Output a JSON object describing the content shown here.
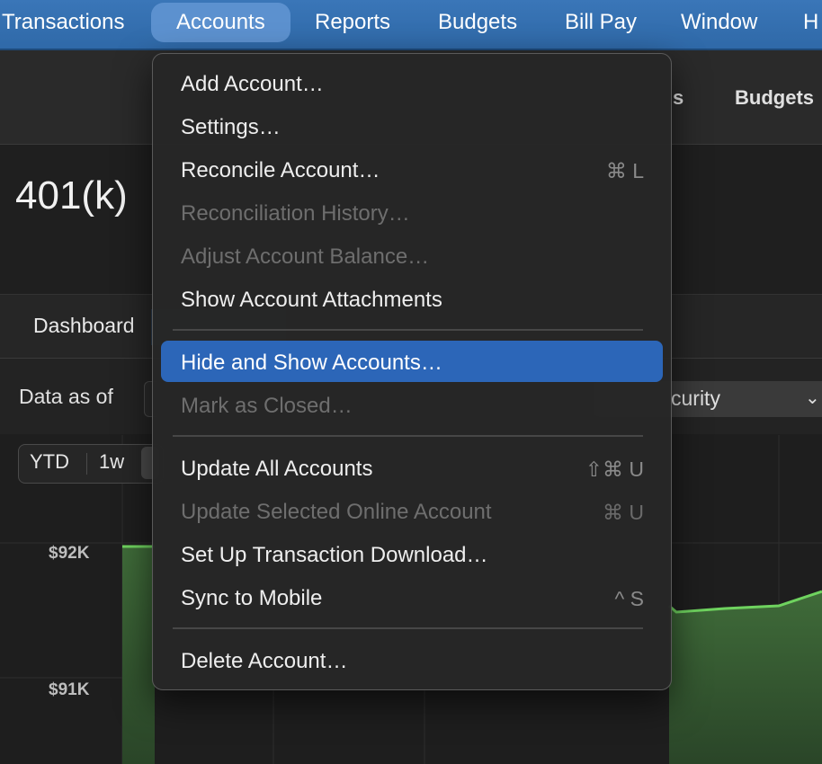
{
  "menubar": {
    "items": [
      "Transactions",
      "Accounts",
      "Reports",
      "Budgets",
      "Bill Pay",
      "Window",
      "H"
    ]
  },
  "toolbar": {
    "reports_partial": "s",
    "budgets": "Budgets"
  },
  "account": {
    "title": "401(k)"
  },
  "tabs": {
    "dashboard": "Dashboard"
  },
  "filters": {
    "data_as_of": "Data as of",
    "security_partial": "curity"
  },
  "range": {
    "ytd": "YTD",
    "week": "1w"
  },
  "chart_data": {
    "type": "area",
    "y_tick_labels": [
      "$92K",
      "$91K"
    ],
    "color": "#6fd35f"
  },
  "menu": {
    "items": [
      {
        "label": "Add Account…",
        "shortcut": "",
        "enabled": true
      },
      {
        "label": "Settings…",
        "shortcut": "",
        "enabled": true
      },
      {
        "label": "Reconcile Account…",
        "shortcut": "⌘ L",
        "enabled": true
      },
      {
        "label": "Reconciliation History…",
        "shortcut": "",
        "enabled": false
      },
      {
        "label": "Adjust Account Balance…",
        "shortcut": "",
        "enabled": false
      },
      {
        "label": "Show Account Attachments",
        "shortcut": "",
        "enabled": true
      },
      {
        "label": "Hide and Show Accounts…",
        "shortcut": "",
        "enabled": true,
        "highlighted": true
      },
      {
        "label": "Mark as Closed…",
        "shortcut": "",
        "enabled": false
      },
      {
        "label": "Update All Accounts",
        "shortcut": "⇧⌘ U",
        "enabled": true
      },
      {
        "label": "Update Selected Online Account",
        "shortcut": "⌘ U",
        "enabled": false
      },
      {
        "label": "Set Up Transaction Download…",
        "shortcut": "",
        "enabled": true
      },
      {
        "label": "Sync to Mobile",
        "shortcut": "^ S",
        "enabled": true
      },
      {
        "label": "Delete Account…",
        "shortcut": "",
        "enabled": true
      }
    ]
  }
}
